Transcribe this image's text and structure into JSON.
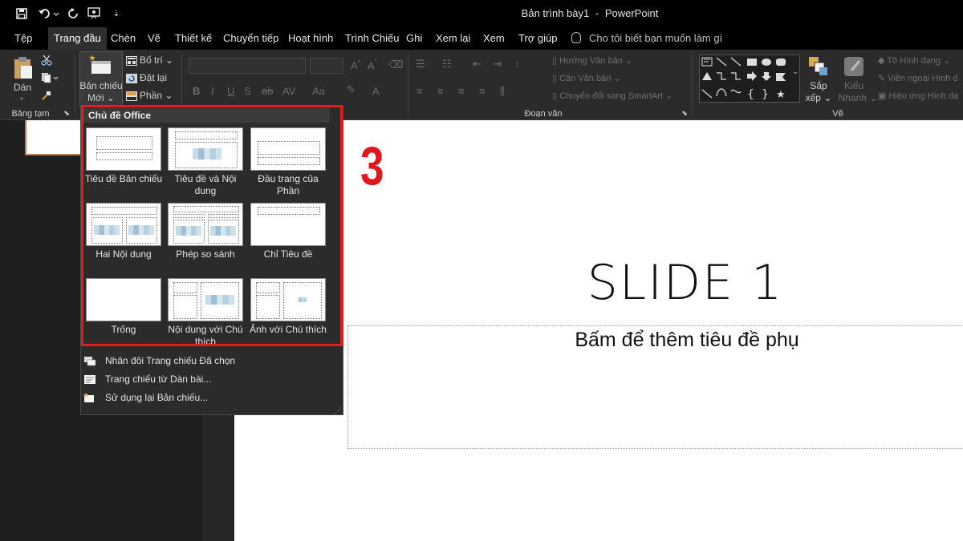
{
  "window": {
    "doc_name": "Bản trình bày1",
    "separator": "-",
    "app_name": "PowerPoint"
  },
  "quick_access": {
    "save_icon": "save-icon",
    "undo_icon": "undo-icon",
    "redo_icon": "redo-icon",
    "present_icon": "present-from-start-icon",
    "customize_icon": "customize-toolbar-icon"
  },
  "tabs": [
    "Tệp",
    "Trang đầu",
    "Chèn",
    "Vẽ",
    "Thiết kế",
    "Chuyển tiếp",
    "Hoạt hình",
    "Trình Chiếu",
    "Ghi",
    "Xem lại",
    "Xem",
    "Trợ giúp"
  ],
  "tell_me": "Cho tôi biết bạn muốn làm gì",
  "ribbon": {
    "paste": "Dán",
    "clipboard_group": "Bảng tạm",
    "new_slide_line1": "Bản chiếu",
    "new_slide_line2": "Mới",
    "layout": "Bố trí",
    "reset": "Đặt lại",
    "section": "Phần",
    "paragraph_group": "Đoạn văn",
    "text_direction": "Hướng Văn bản",
    "align_text": "Căn Văn bản",
    "convert_smartart": "Chuyển đổi sang SmartArt",
    "arrange_line1": "Sắp",
    "arrange_line2": "xếp",
    "quick_styles_line1": "Kiểu",
    "quick_styles_line2": "Nhanh",
    "shape_fill": "Tô Hình dạng",
    "shape_outline": "Viền ngoài Hình d",
    "shape_effects": "Hiệu ứng Hình dạ",
    "drawing_group": "Vẽ"
  },
  "dropdown": {
    "header": "Chủ đề Office",
    "layouts": [
      {
        "name": "Tiêu đề Bản chiếu"
      },
      {
        "name": "Tiêu đề và Nội dung"
      },
      {
        "name": "Đầu trang của Phần"
      },
      {
        "name": "Hai Nội dung"
      },
      {
        "name": "Phép so sánh"
      },
      {
        "name": "Chỉ Tiêu đề"
      },
      {
        "name": "Trống"
      },
      {
        "name": "Nội dung với Chú thích"
      },
      {
        "name": "Ảnh với Chú thích"
      }
    ],
    "actions": [
      "Nhân đôi Trang chiếu Đã chọn",
      "Trang chiếu từ Dàn bài...",
      "Sử dụng lại Bản chiếu..."
    ]
  },
  "slide": {
    "title": "SLIDE 1",
    "subtitle": "Bấm để thêm tiêu đề phụ"
  },
  "annotation": {
    "step_number": "3",
    "color": "#e0161b"
  },
  "colors": {
    "accent_box": "#e21b1b",
    "ribbon_bg": "#2b2b2b",
    "titlebar_bg": "#000000"
  }
}
